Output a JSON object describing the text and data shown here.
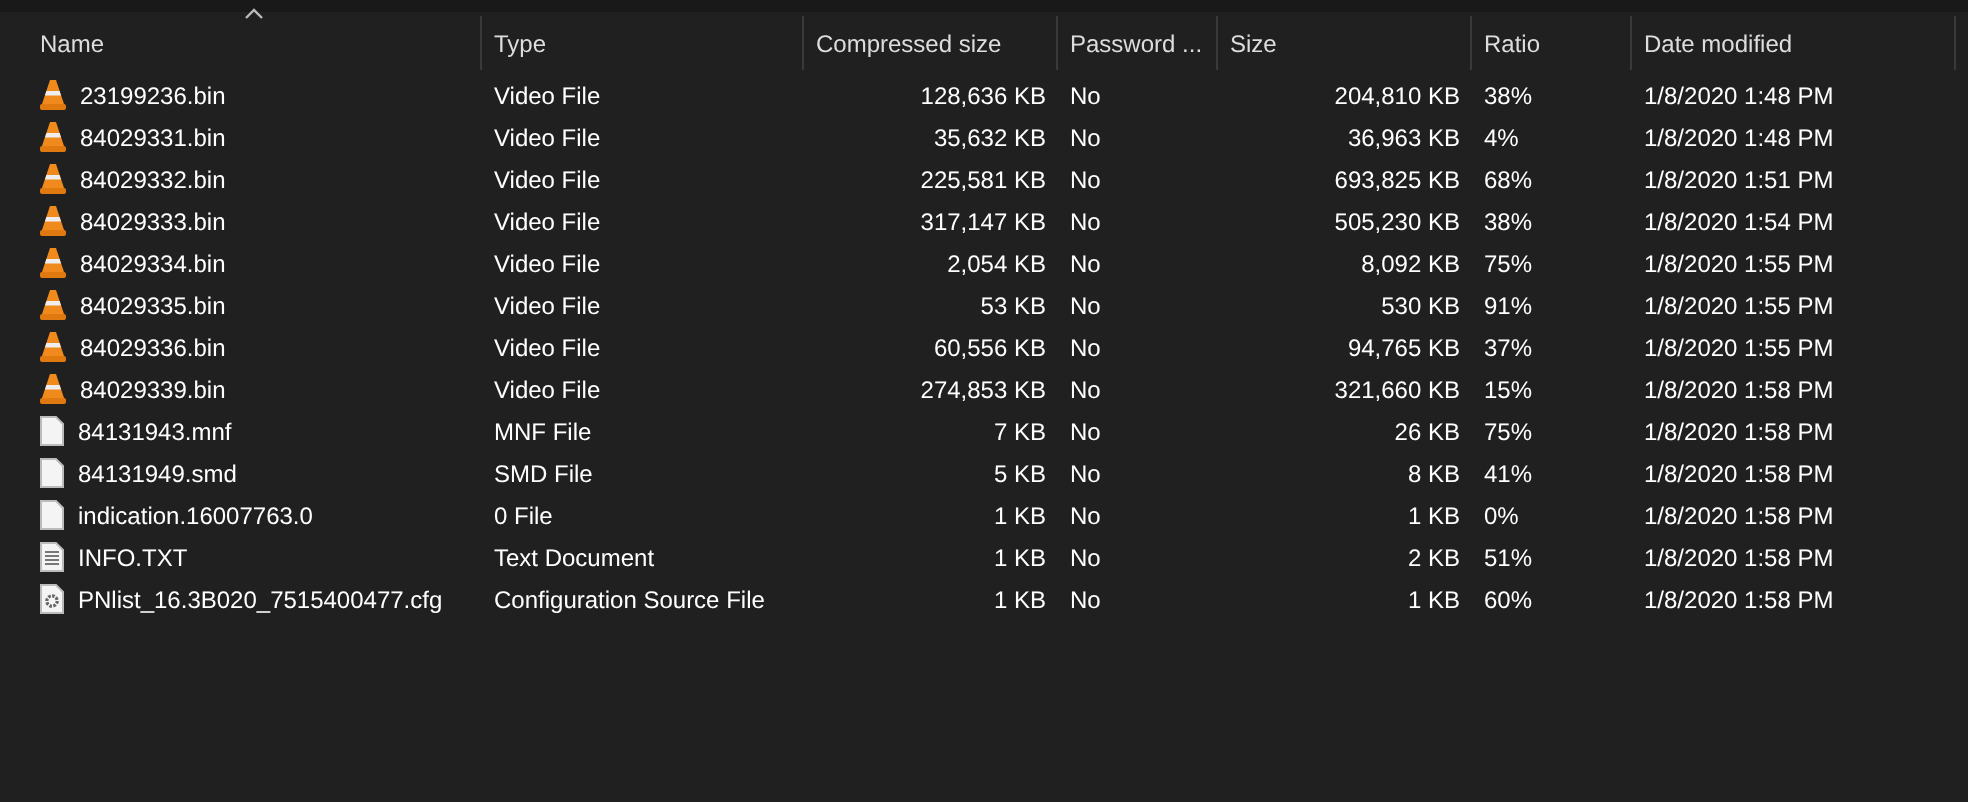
{
  "columns": [
    {
      "label": "Name",
      "sorted": true
    },
    {
      "label": "Type",
      "sorted": false
    },
    {
      "label": "Compressed size",
      "sorted": false
    },
    {
      "label": "Password ...",
      "sorted": false
    },
    {
      "label": "Size",
      "sorted": false
    },
    {
      "label": "Ratio",
      "sorted": false
    },
    {
      "label": "Date modified",
      "sorted": false
    }
  ],
  "rows": [
    {
      "kind": "video",
      "name": "23199236.bin",
      "type": "Video File",
      "compressed_size": "128,636 KB",
      "password": "No",
      "size": "204,810 KB",
      "ratio": "38%",
      "date_modified": "1/8/2020 1:48 PM"
    },
    {
      "kind": "video",
      "name": "84029331.bin",
      "type": "Video File",
      "compressed_size": "35,632 KB",
      "password": "No",
      "size": "36,963 KB",
      "ratio": "4%",
      "date_modified": "1/8/2020 1:48 PM"
    },
    {
      "kind": "video",
      "name": "84029332.bin",
      "type": "Video File",
      "compressed_size": "225,581 KB",
      "password": "No",
      "size": "693,825 KB",
      "ratio": "68%",
      "date_modified": "1/8/2020 1:51 PM"
    },
    {
      "kind": "video",
      "name": "84029333.bin",
      "type": "Video File",
      "compressed_size": "317,147 KB",
      "password": "No",
      "size": "505,230 KB",
      "ratio": "38%",
      "date_modified": "1/8/2020 1:54 PM"
    },
    {
      "kind": "video",
      "name": "84029334.bin",
      "type": "Video File",
      "compressed_size": "2,054 KB",
      "password": "No",
      "size": "8,092 KB",
      "ratio": "75%",
      "date_modified": "1/8/2020 1:55 PM"
    },
    {
      "kind": "video",
      "name": "84029335.bin",
      "type": "Video File",
      "compressed_size": "53 KB",
      "password": "No",
      "size": "530 KB",
      "ratio": "91%",
      "date_modified": "1/8/2020 1:55 PM"
    },
    {
      "kind": "video",
      "name": "84029336.bin",
      "type": "Video File",
      "compressed_size": "60,556 KB",
      "password": "No",
      "size": "94,765 KB",
      "ratio": "37%",
      "date_modified": "1/8/2020 1:55 PM"
    },
    {
      "kind": "video",
      "name": "84029339.bin",
      "type": "Video File",
      "compressed_size": "274,853 KB",
      "password": "No",
      "size": "321,660 KB",
      "ratio": "15%",
      "date_modified": "1/8/2020 1:58 PM"
    },
    {
      "kind": "blank",
      "name": "84131943.mnf",
      "type": "MNF File",
      "compressed_size": "7 KB",
      "password": "No",
      "size": "26 KB",
      "ratio": "75%",
      "date_modified": "1/8/2020 1:58 PM"
    },
    {
      "kind": "blank",
      "name": "84131949.smd",
      "type": "SMD File",
      "compressed_size": "5 KB",
      "password": "No",
      "size": "8 KB",
      "ratio": "41%",
      "date_modified": "1/8/2020 1:58 PM"
    },
    {
      "kind": "blank",
      "name": "indication.16007763.0",
      "type": "0 File",
      "compressed_size": "1 KB",
      "password": "No",
      "size": "1 KB",
      "ratio": "0%",
      "date_modified": "1/8/2020 1:58 PM"
    },
    {
      "kind": "text",
      "name": "INFO.TXT",
      "type": "Text Document",
      "compressed_size": "1 KB",
      "password": "No",
      "size": "2 KB",
      "ratio": "51%",
      "date_modified": "1/8/2020 1:58 PM"
    },
    {
      "kind": "config",
      "name": "PNlist_16.3B020_7515400477.cfg",
      "type": "Configuration Source File",
      "compressed_size": "1 KB",
      "password": "No",
      "size": "1 KB",
      "ratio": "60%",
      "date_modified": "1/8/2020 1:58 PM"
    }
  ]
}
